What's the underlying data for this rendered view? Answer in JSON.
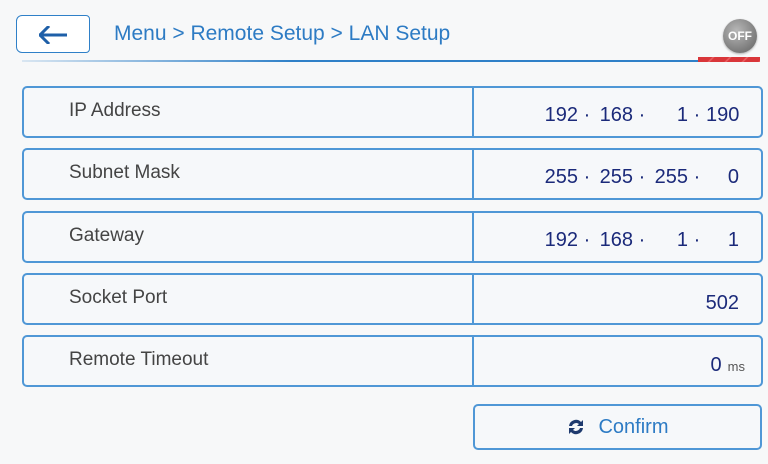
{
  "header": {
    "breadcrumb": "Menu > Remote Setup > LAN Setup",
    "status_badge": "OFF"
  },
  "rows": [
    {
      "label": "IP Address",
      "octets": [
        "192",
        "168",
        "1",
        "190"
      ]
    },
    {
      "label": "Subnet Mask",
      "octets": [
        "255",
        "255",
        "255",
        "0"
      ]
    },
    {
      "label": "Gateway",
      "octets": [
        "192",
        "168",
        "1",
        "1"
      ]
    },
    {
      "label": "Socket Port",
      "value": "502"
    },
    {
      "label": "Remote Timeout",
      "value": "0",
      "unit": "ms"
    }
  ],
  "separator": "·",
  "confirm": {
    "label": "Confirm",
    "icon": "refresh-icon"
  },
  "colors": {
    "accent": "#2f80c8",
    "value_text": "#1b2a7a",
    "status_stripe": "#d9363a"
  }
}
